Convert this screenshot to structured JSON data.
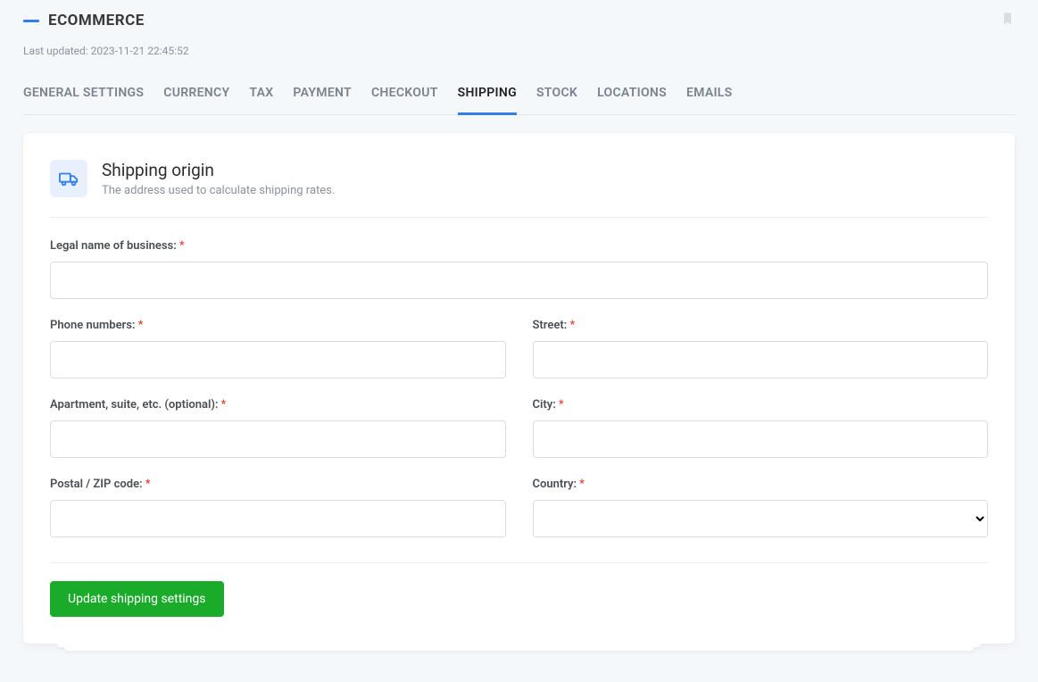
{
  "header": {
    "title": "ECOMMERCE",
    "last_updated": "Last updated: 2023-11-21 22:45:52"
  },
  "tabs": [
    {
      "label": "GENERAL SETTINGS",
      "active": false
    },
    {
      "label": "CURRENCY",
      "active": false
    },
    {
      "label": "TAX",
      "active": false
    },
    {
      "label": "PAYMENT",
      "active": false
    },
    {
      "label": "CHECKOUT",
      "active": false
    },
    {
      "label": "SHIPPING",
      "active": true
    },
    {
      "label": "STOCK",
      "active": false
    },
    {
      "label": "LOCATIONS",
      "active": false
    },
    {
      "label": "EMAILS",
      "active": false
    }
  ],
  "section": {
    "title": "Shipping origin",
    "description": "The address used to calculate shipping rates."
  },
  "fields": {
    "legal_name": {
      "label": "Legal name of business:",
      "required": true,
      "value": ""
    },
    "phone": {
      "label": "Phone numbers:",
      "required": true,
      "value": ""
    },
    "street": {
      "label": "Street:",
      "required": true,
      "value": ""
    },
    "apartment": {
      "label": "Apartment, suite, etc. (optional):",
      "required": true,
      "value": ""
    },
    "city": {
      "label": "City:",
      "required": true,
      "value": ""
    },
    "postal": {
      "label": "Postal / ZIP code:",
      "required": true,
      "value": ""
    },
    "country": {
      "label": "Country:",
      "required": true,
      "value": ""
    }
  },
  "required_marker": "*",
  "actions": {
    "submit_label": "Update shipping settings"
  }
}
